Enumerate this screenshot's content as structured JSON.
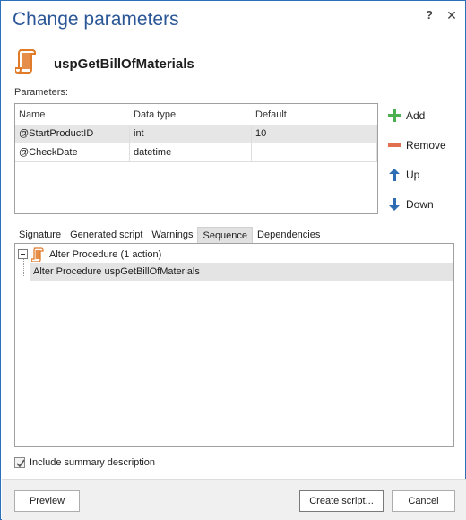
{
  "window": {
    "title": "Change parameters",
    "help_label": "?",
    "close_label": "✕"
  },
  "object": {
    "name": "uspGetBillOfMaterials",
    "icon": "stored-procedure-icon",
    "icon_color": "#e07b2a"
  },
  "parameters": {
    "label": "Parameters:",
    "columns": [
      "Name",
      "Data type",
      "Default"
    ],
    "rows": [
      {
        "name": "@StartProductID",
        "type": "int",
        "default": "10"
      },
      {
        "name": "@CheckDate",
        "type": "datetime",
        "default": ""
      }
    ]
  },
  "actions": {
    "add": "Add",
    "remove": "Remove",
    "up": "Up",
    "down": "Down",
    "add_color": "#4caf50",
    "remove_color": "#e07050",
    "arrow_color": "#2e6db4"
  },
  "tabs": {
    "items": [
      "Signature",
      "Generated script",
      "Warnings",
      "Sequence",
      "Dependencies"
    ],
    "active": "Sequence"
  },
  "sequence": {
    "group_label": "Alter Procedure (1 action)",
    "item_label": "Alter Procedure uspGetBillOfMaterials"
  },
  "options": {
    "include_summary_label": "Include summary description",
    "include_summary_checked": true
  },
  "footer": {
    "preview": "Preview",
    "create_script": "Create script...",
    "cancel": "Cancel"
  }
}
